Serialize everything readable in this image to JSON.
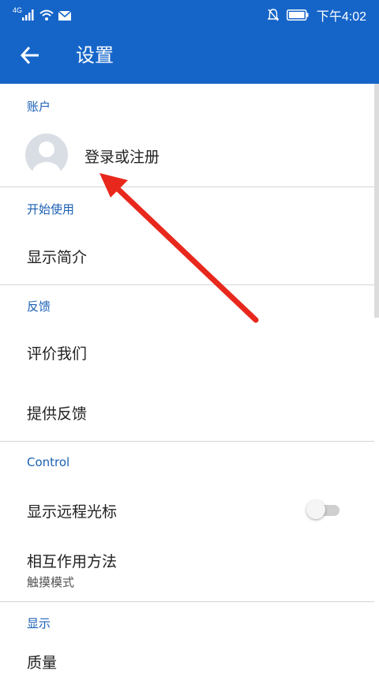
{
  "status_bar": {
    "network_label": "4G",
    "time": "下午4:02"
  },
  "app_bar": {
    "title": "设置"
  },
  "sections": {
    "account": {
      "header": "账户",
      "sign_in_label": "登录或注册"
    },
    "getting_started": {
      "header": "开始使用",
      "show_intro_label": "显示简介"
    },
    "feedback": {
      "header": "反馈",
      "rate_us_label": "评价我们",
      "give_feedback_label": "提供反馈"
    },
    "control": {
      "header": "Control",
      "show_remote_cursor_label": "显示远程光标",
      "remote_cursor_enabled": false,
      "interaction_method_label": "相互作用方法",
      "interaction_method_value": "触摸模式"
    },
    "display": {
      "header": "显示",
      "quality_label": "质量"
    }
  },
  "colors": {
    "brand_blue": "#1565c9",
    "section_header_blue": "#1a5fb4",
    "annotation_red": "#e8281c"
  },
  "icons": [
    "back-arrow-icon",
    "signal-icon",
    "wifi-icon",
    "mail-icon",
    "mute-icon",
    "battery-icon",
    "avatar-icon"
  ]
}
